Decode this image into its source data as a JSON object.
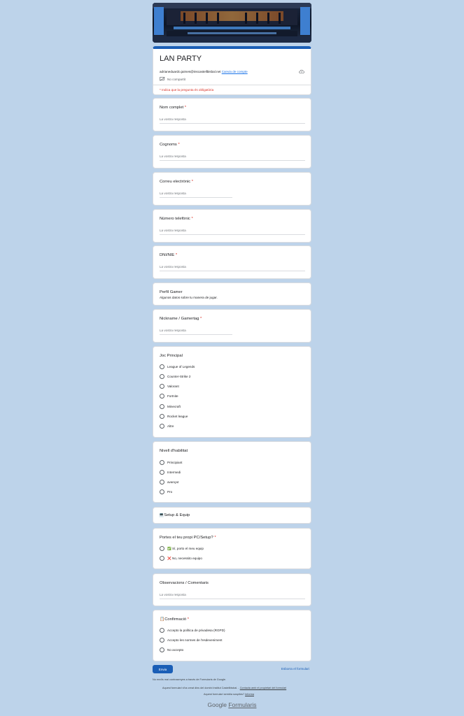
{
  "form": {
    "title": "LAN PARTY",
    "email": "adrianeduardo.jaimes@inscastellbisbal.net",
    "switch_account": "Canvia de compte",
    "not_shared": "No compartit",
    "required_note": "* Indica que la pregunta és obligatòria"
  },
  "questions": {
    "nom": {
      "label": "Nom complet",
      "star": "*",
      "placeholder": "La vostra resposta"
    },
    "cognoms": {
      "label": "Cognoms",
      "star": "*",
      "placeholder": "La vostra resposta"
    },
    "correu": {
      "label": "Correu electrònic",
      "star": "*",
      "placeholder": "La vostra resposta"
    },
    "telefon": {
      "label": "Número telefònic",
      "star": "*",
      "placeholder": "La vostra resposta"
    },
    "dni": {
      "label": "DNI/NIE",
      "star": "*",
      "placeholder": "La vostra resposta"
    },
    "perfil": {
      "label": "Perfil Gamer",
      "desc": "Algunos datos sobre tu manera de jugar."
    },
    "nickname": {
      "label": "Nickname / Gamertag",
      "star": "*",
      "placeholder": "La vostra resposta"
    },
    "joc": {
      "label": "Joc Principal",
      "options": [
        "League of Legends",
        "Counter-Strike 2",
        "Valorant",
        "Fortnite",
        "Minecraft",
        "Rocket league",
        "Altre"
      ]
    },
    "nivell": {
      "label": "Nivell d'habilitat",
      "options": [
        "Principiant",
        "Intermedi",
        "avançat",
        "Pro"
      ]
    },
    "setup_section": {
      "label": "💻Setup & Equip"
    },
    "pc": {
      "label": "Portes el teu propi PC/Setup?",
      "star": "*",
      "options": [
        "✅ Sí, porto el meu equip",
        "❌ No, necessito equipo"
      ]
    },
    "observacions": {
      "label": "Observacions / Comentaris",
      "placeholder": "La vostra resposta"
    },
    "confirmacio": {
      "label": "📋Confirmació",
      "star": "*",
      "options": [
        "Accepto la política de privadesa (RGPD)",
        "Accepto les normes de l'esdeveniment",
        "No accepto"
      ]
    }
  },
  "footer": {
    "submit": "Envia",
    "clear": "Esborra el formulari",
    "never_passwords": "No enviïs mai contrasenyes a través de Formularis de Google.",
    "created_in": "Aquest formulari s'ha creat dins del domini Institut Castellbisbal.",
    "contact_owner": "Contacta amb el propietari del formulari",
    "suspicious": "Aquest formulari sembla sospitós?",
    "report": "Informa",
    "logo_google": "Google",
    "logo_forms": "Formularis"
  }
}
